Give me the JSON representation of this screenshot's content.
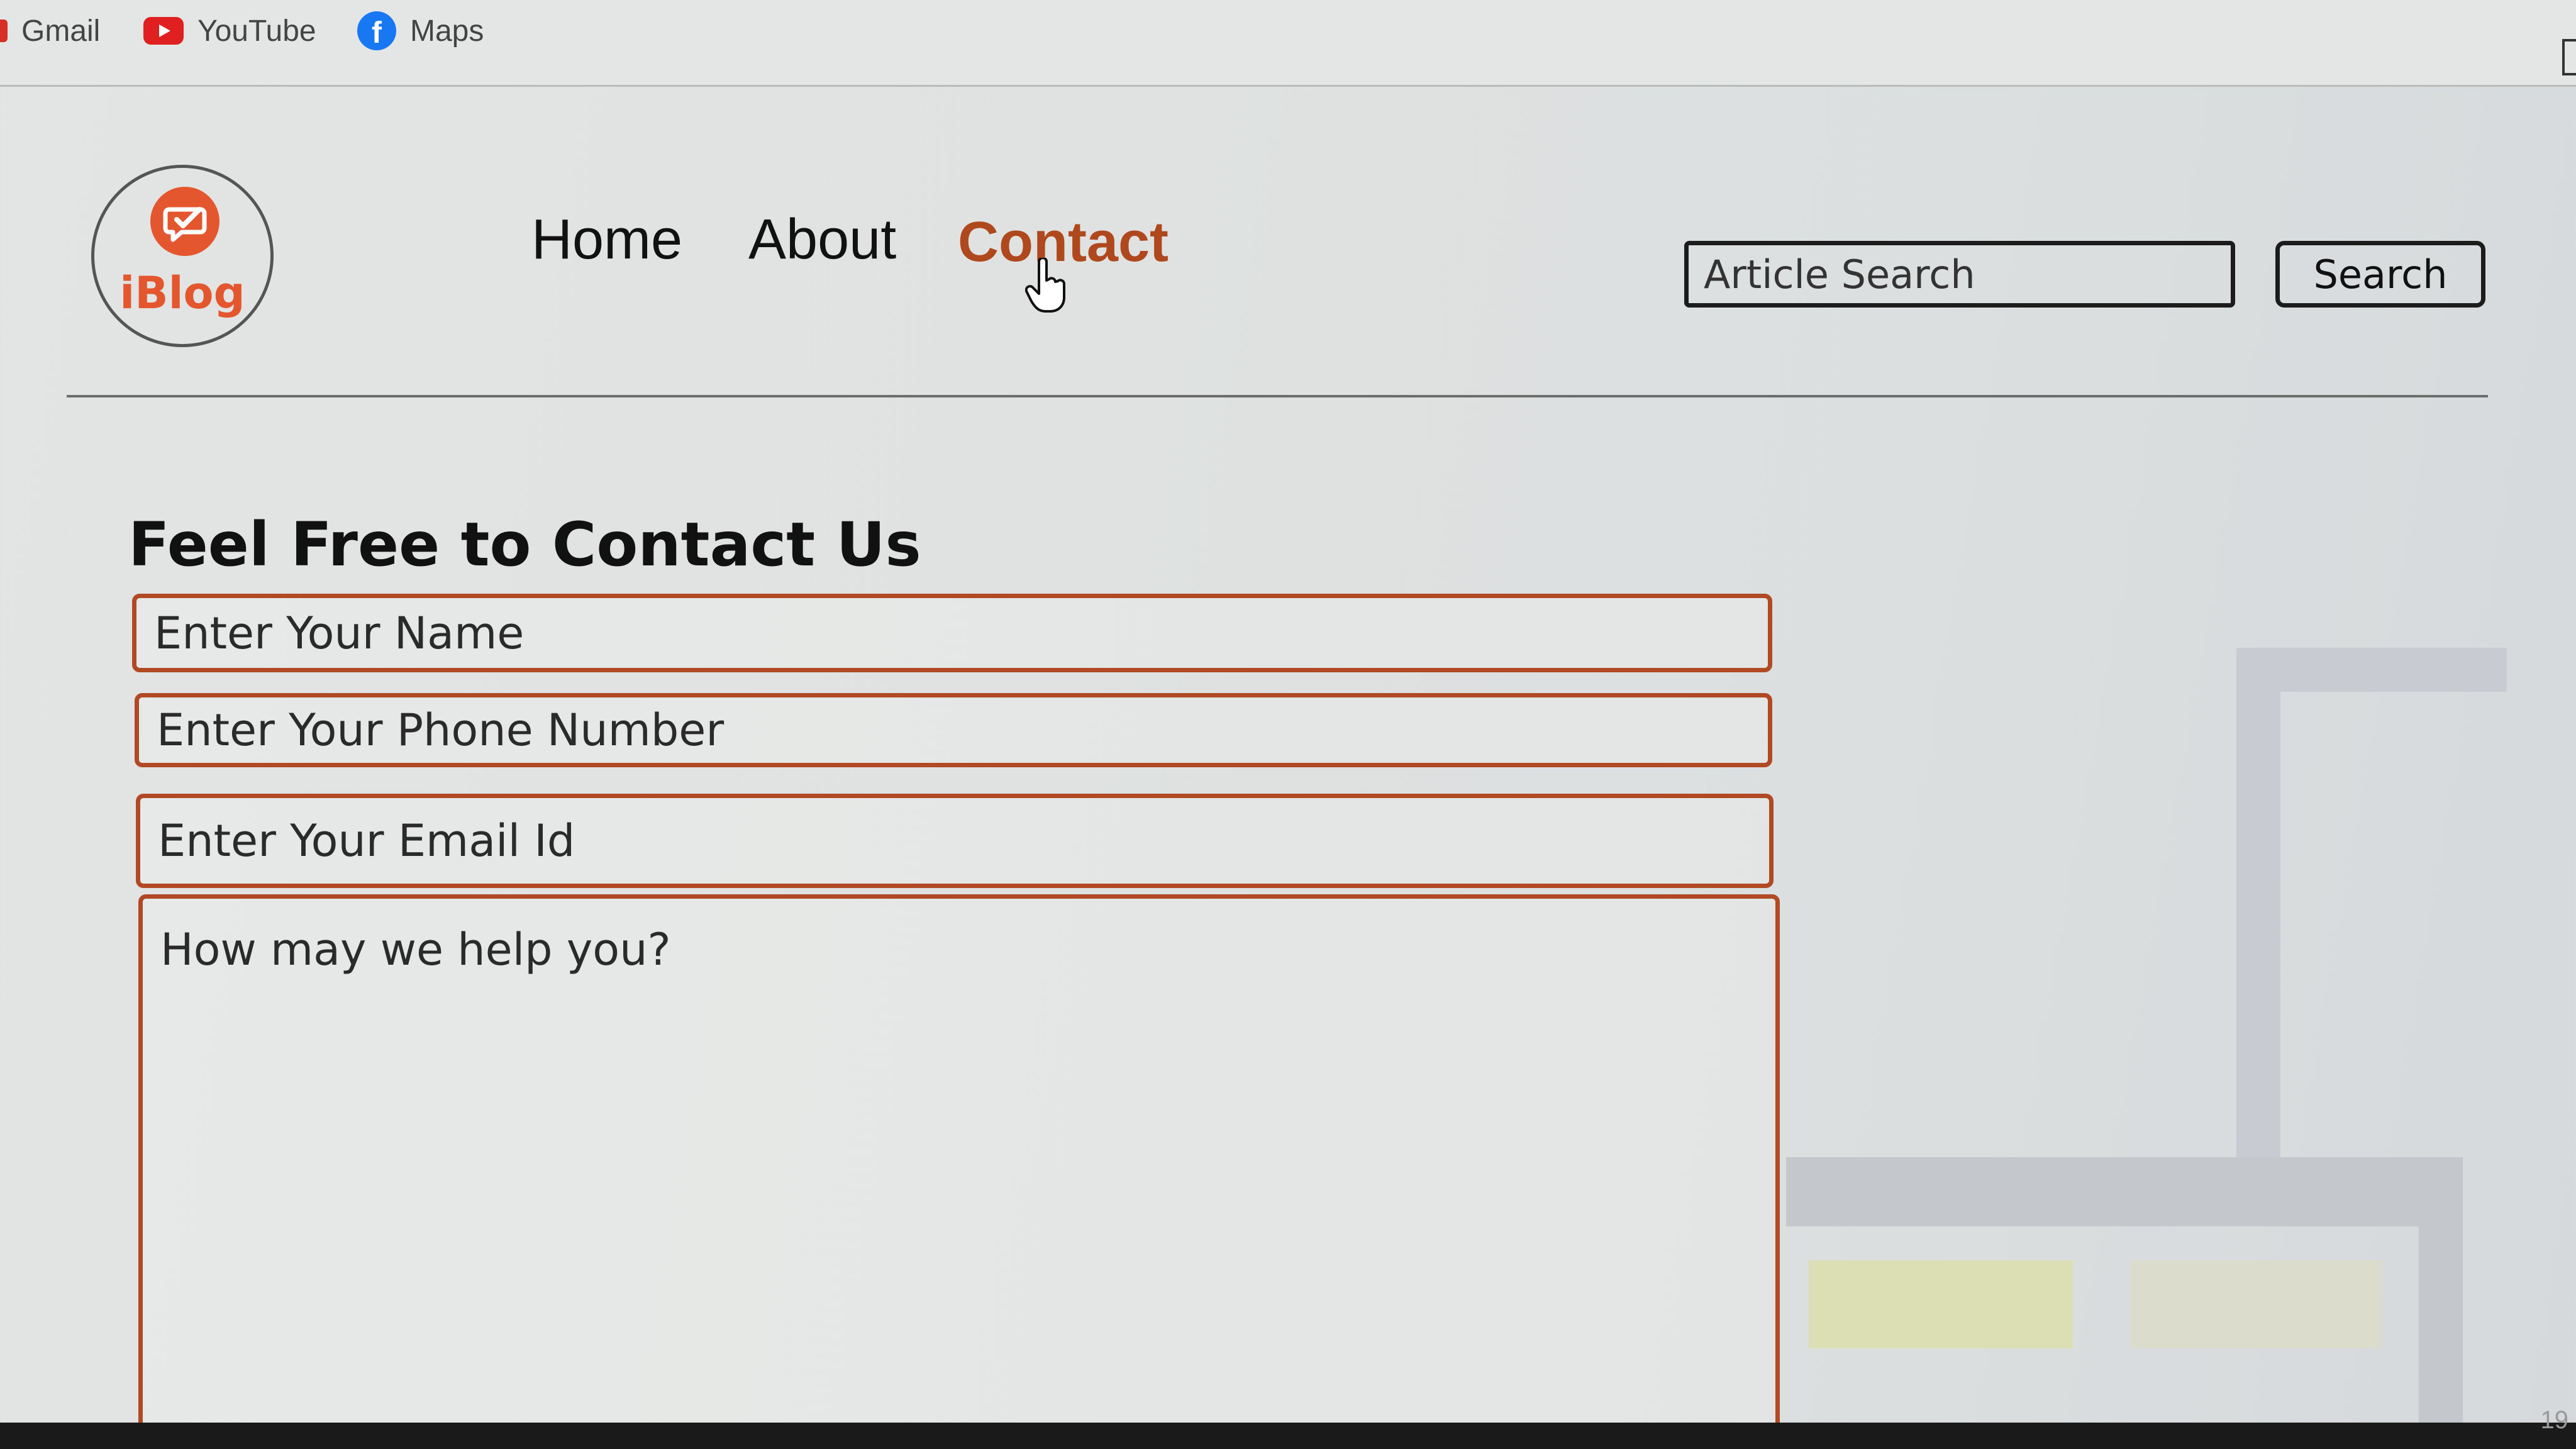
{
  "bookmarks": {
    "items": [
      {
        "label": "Gmail",
        "icon": "gmail-icon"
      },
      {
        "label": "YouTube",
        "icon": "youtube-icon"
      },
      {
        "label": "Maps",
        "icon": "facebook-icon"
      }
    ]
  },
  "header": {
    "logo_text": "iBlog",
    "nav": [
      {
        "label": "Home"
      },
      {
        "label": "About"
      },
      {
        "label": "Contact",
        "active": true
      }
    ],
    "search": {
      "placeholder": "Article Search",
      "button_label": "Search"
    }
  },
  "contact_form": {
    "title": "Feel Free to Contact Us",
    "name_placeholder": "Enter Your Name",
    "phone_placeholder": "Enter Your Phone Number",
    "email_placeholder": "Enter Your Email Id",
    "message_placeholder": "How may we help you?"
  },
  "colors": {
    "accent": "#b0481d",
    "field_border": "#b14a24",
    "logo": "#e4572e"
  },
  "taskbar": {
    "time_fragment": "19"
  }
}
